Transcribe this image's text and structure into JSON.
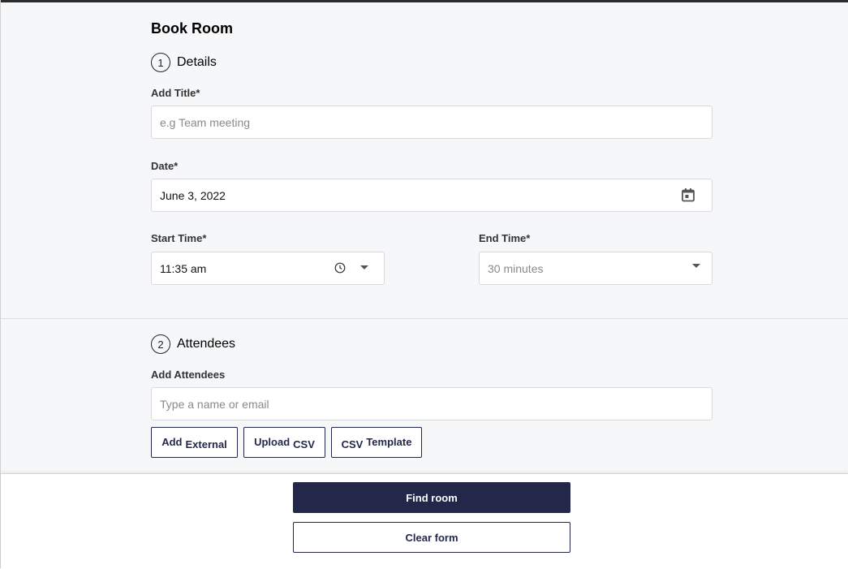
{
  "page": {
    "title": "Book Room"
  },
  "details": {
    "step_number": "1",
    "heading": "Details",
    "title_field": {
      "label": "Add Title*",
      "placeholder": "e.g Team meeting",
      "value": ""
    },
    "date_field": {
      "label": "Date*",
      "value": "June 3, 2022",
      "icon": "calendar-icon"
    },
    "start_time": {
      "label": "Start Time*",
      "value": "11:35 am",
      "icons": [
        "clock-icon",
        "chevron-down-icon"
      ]
    },
    "end_time": {
      "label": "End Time*",
      "value": "30 minutes",
      "icon": "chevron-down-icon"
    }
  },
  "attendees": {
    "step_number": "2",
    "heading": "Attendees",
    "field": {
      "label": "Add Attendees",
      "placeholder": "Type a name or email"
    },
    "buttons": {
      "add_external": [
        "Add",
        "External"
      ],
      "upload_csv": [
        "Upload",
        "CSV"
      ],
      "csv_template": [
        "CSV",
        "Template"
      ]
    }
  },
  "footer": {
    "find_room": "Find room",
    "clear_form": "Clear form"
  },
  "colors": {
    "primary": "#23284b",
    "background": "#f6f7f9",
    "border": "#d9d9dd"
  }
}
